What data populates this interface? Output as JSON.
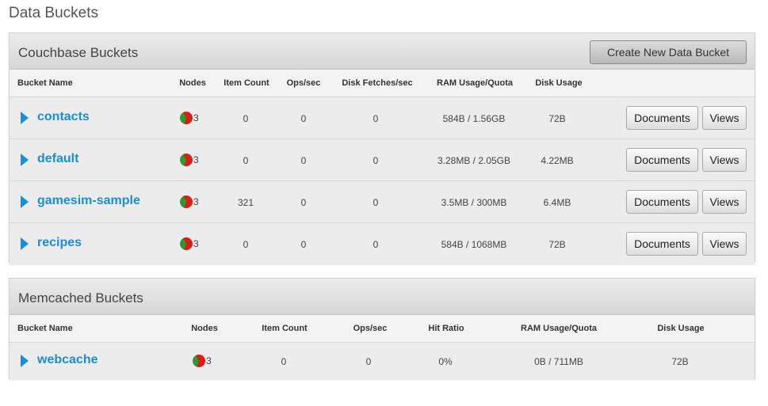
{
  "page": {
    "title": "Data Buckets"
  },
  "couchbase": {
    "title": "Couchbase Buckets",
    "create_button": "Create New Data Bucket",
    "columns": {
      "name": "Bucket Name",
      "nodes": "Nodes",
      "items": "Item Count",
      "ops": "Ops/sec",
      "fetches": "Disk Fetches/sec",
      "ram": "RAM Usage/Quota",
      "disk": "Disk Usage"
    },
    "documents_label": "Documents",
    "views_label": "Views",
    "rows": [
      {
        "name": "contacts",
        "nodes": "3",
        "items": "0",
        "ops": "0",
        "fetches": "0",
        "ram": "584B / 1.56GB",
        "disk": "72B"
      },
      {
        "name": "default",
        "nodes": "3",
        "items": "0",
        "ops": "0",
        "fetches": "0",
        "ram": "3.28MB / 2.05GB",
        "disk": "4.22MB"
      },
      {
        "name": "gamesim-sample",
        "nodes": "3",
        "items": "321",
        "ops": "0",
        "fetches": "0",
        "ram": "3.5MB / 300MB",
        "disk": "6.4MB"
      },
      {
        "name": "recipes",
        "nodes": "3",
        "items": "0",
        "ops": "0",
        "fetches": "0",
        "ram": "584B / 1068MB",
        "disk": "72B"
      }
    ]
  },
  "memcached": {
    "title": "Memcached Buckets",
    "columns": {
      "name": "Bucket Name",
      "nodes": "Nodes",
      "items": "Item Count",
      "ops": "Ops/sec",
      "hit": "Hit Ratio",
      "ram": "RAM Usage/Quota",
      "disk": "Disk Usage"
    },
    "rows": [
      {
        "name": "webcache",
        "nodes": "3",
        "items": "0",
        "ops": "0",
        "hit": "0%",
        "ram": "0B / 711MB",
        "disk": "72B"
      }
    ]
  },
  "colors": {
    "link": "#1a8ed6",
    "node_down": "#d91e18",
    "node_up": "#2e9a2e"
  },
  "icons": {
    "expand": "triangle-right-icon",
    "node_status": "node-status-pie-icon"
  }
}
